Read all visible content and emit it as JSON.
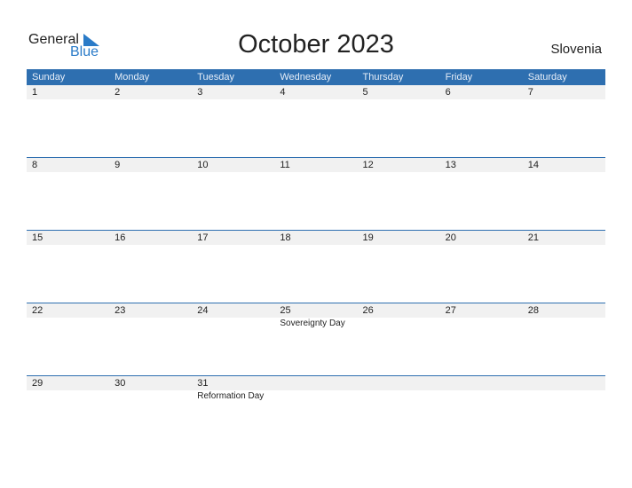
{
  "logo": {
    "text1": "General",
    "text2": "Blue"
  },
  "title": "October 2023",
  "country": "Slovenia",
  "weekdays": [
    "Sunday",
    "Monday",
    "Tuesday",
    "Wednesday",
    "Thursday",
    "Friday",
    "Saturday"
  ],
  "weeks": [
    {
      "dates": [
        "1",
        "2",
        "3",
        "4",
        "5",
        "6",
        "7"
      ],
      "events": [
        "",
        "",
        "",
        "",
        "",
        "",
        ""
      ]
    },
    {
      "dates": [
        "8",
        "9",
        "10",
        "11",
        "12",
        "13",
        "14"
      ],
      "events": [
        "",
        "",
        "",
        "",
        "",
        "",
        ""
      ]
    },
    {
      "dates": [
        "15",
        "16",
        "17",
        "18",
        "19",
        "20",
        "21"
      ],
      "events": [
        "",
        "",
        "",
        "",
        "",
        "",
        ""
      ]
    },
    {
      "dates": [
        "22",
        "23",
        "24",
        "25",
        "26",
        "27",
        "28"
      ],
      "events": [
        "",
        "",
        "",
        "Sovereignty Day",
        "",
        "",
        ""
      ]
    },
    {
      "dates": [
        "29",
        "30",
        "31",
        "",
        "",
        "",
        ""
      ],
      "events": [
        "",
        "",
        "Reformation Day",
        "",
        "",
        "",
        ""
      ]
    }
  ],
  "colors": {
    "header": "#2e6fb0",
    "accent": "#2a7bc8",
    "date_strip": "#f1f1f1"
  }
}
